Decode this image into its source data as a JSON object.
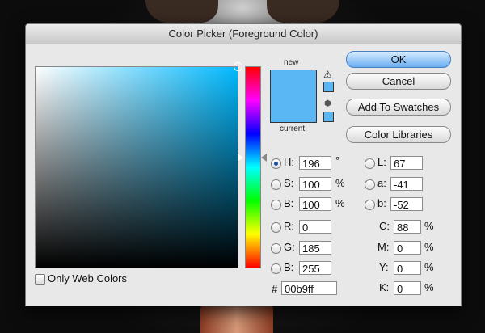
{
  "window": {
    "title": "Color Picker (Foreground Color)"
  },
  "preview": {
    "new_label": "new",
    "current_label": "current",
    "new_color": "#5ab7f3",
    "current_color": "#5ab7f3",
    "field_hue_color": "#00b9ff"
  },
  "buttons": {
    "ok": "OK",
    "cancel": "Cancel",
    "add_to_swatches": "Add To Swatches",
    "color_libraries": "Color Libraries"
  },
  "hsb": {
    "h": {
      "label": "H:",
      "value": "196",
      "unit": "°"
    },
    "s": {
      "label": "S:",
      "value": "100",
      "unit": "%"
    },
    "b": {
      "label": "B:",
      "value": "100",
      "unit": "%"
    }
  },
  "rgb": {
    "r": {
      "label": "R:",
      "value": "0"
    },
    "g": {
      "label": "G:",
      "value": "185"
    },
    "b": {
      "label": "B:",
      "value": "255"
    }
  },
  "lab": {
    "l": {
      "label": "L:",
      "value": "67"
    },
    "a": {
      "label": "a:",
      "value": "-41"
    },
    "b": {
      "label": "b:",
      "value": "-52"
    }
  },
  "cmyk": {
    "c": {
      "label": "C:",
      "value": "88",
      "unit": "%"
    },
    "m": {
      "label": "M:",
      "value": "0",
      "unit": "%"
    },
    "y": {
      "label": "Y:",
      "value": "0",
      "unit": "%"
    },
    "k": {
      "label": "K:",
      "value": "0",
      "unit": "%"
    }
  },
  "hex": {
    "label": "#",
    "value": "00b9ff"
  },
  "web_colors": {
    "label": "Only Web Colors",
    "checked": false
  },
  "icons": {
    "warning": "warning-triangle-icon",
    "cube": "web-safe-cube-icon"
  }
}
